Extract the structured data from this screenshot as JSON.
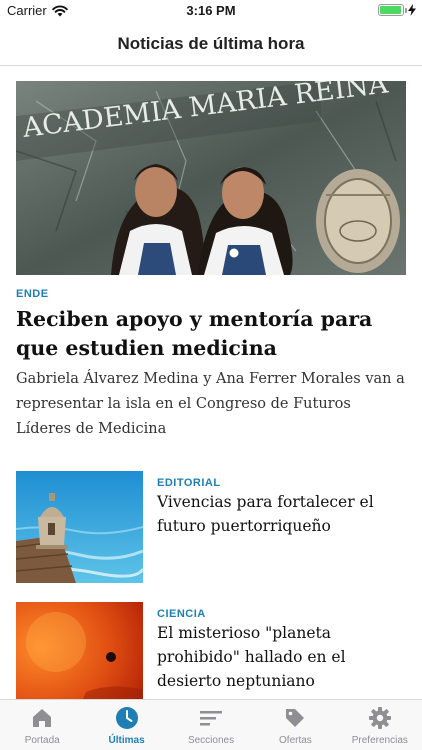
{
  "status_bar": {
    "carrier": "Carrier",
    "time": "3:16 PM",
    "battery_level": 0.95,
    "icons": [
      "wifi-icon",
      "battery-icon",
      "charging-bolt-icon"
    ]
  },
  "nav": {
    "title": "Noticias de última hora"
  },
  "hero": {
    "image_text": "ACADEMIA MARIA REINA",
    "kicker": "ENDE",
    "title": "Reciben apoyo y mentoría para que estudien medicina",
    "summary": "Gabriela Álvarez Medina y Ana Ferrer Morales van a representar la isla en el Congreso de Futuros Líderes de Medicina"
  },
  "articles": [
    {
      "kicker": "EDITORIAL",
      "title": "Vivencias para fortalecer el futuro puertorriqueño"
    },
    {
      "kicker": "CIENCIA",
      "title": "El misterioso \"planeta prohibido\" hallado en el desierto neptuniano"
    }
  ],
  "tabs": [
    {
      "label": "Portada",
      "icon": "home-icon",
      "active": false
    },
    {
      "label": "Últimas",
      "icon": "clock-icon",
      "active": true
    },
    {
      "label": "Secciones",
      "icon": "sections-icon",
      "active": false
    },
    {
      "label": "Ofertas",
      "icon": "tag-icon",
      "active": false
    },
    {
      "label": "Preferencias",
      "icon": "gear-icon",
      "active": false
    }
  ],
  "colors": {
    "accent": "#1f7fb4",
    "inactive": "#8e8e93",
    "battery": "#4cd964"
  }
}
